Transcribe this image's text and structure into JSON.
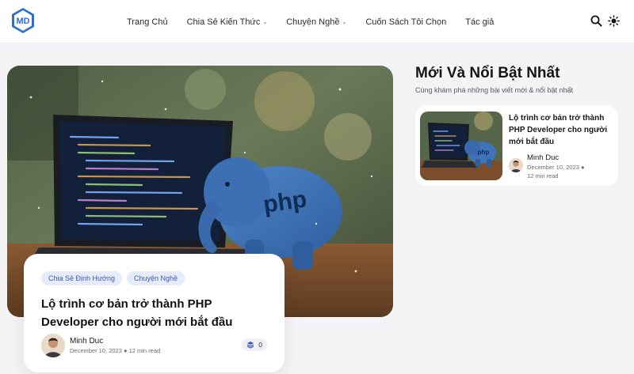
{
  "header": {
    "logo_text": "MD",
    "nav": [
      {
        "label": "Trang Chủ",
        "has_dropdown": false
      },
      {
        "label": "Chia Sẻ Kiến Thức",
        "has_dropdown": true
      },
      {
        "label": "Chuyện Nghề",
        "has_dropdown": true
      },
      {
        "label": "Cuốn Sách Tôi Chọn",
        "has_dropdown": false
      },
      {
        "label": "Tác giả",
        "has_dropdown": false
      }
    ],
    "icons": [
      "search-icon",
      "sun-icon"
    ]
  },
  "hero": {
    "image_text": "php",
    "tags": [
      "Chia Sẻ Định Hướng",
      "Chuyện Nghề"
    ],
    "title": "Lộ trình cơ bản trở thành PHP Developer cho người mới bắt đầu",
    "author": "Minh Duc",
    "date": "December 10, 2023",
    "read_time": "12 min read",
    "comments": "0"
  },
  "sidebar": {
    "title": "Mới Và Nổi Bật Nhất",
    "subtitle": "Cùng khám phá những bài viết mới & nổi bật nhất",
    "posts": [
      {
        "title": "Lộ trình cơ bản trở thành PHP Developer cho người mới bắt đầu",
        "author": "Minh Duc",
        "date": "December 10, 2023",
        "read_time": "12 min read",
        "image_text": "php"
      }
    ]
  },
  "colors": {
    "accent": "#3a56b8",
    "tag_bg": "#e6ecfb",
    "logo": "#2f6fd1",
    "page_bg": "#f4f4f6"
  }
}
